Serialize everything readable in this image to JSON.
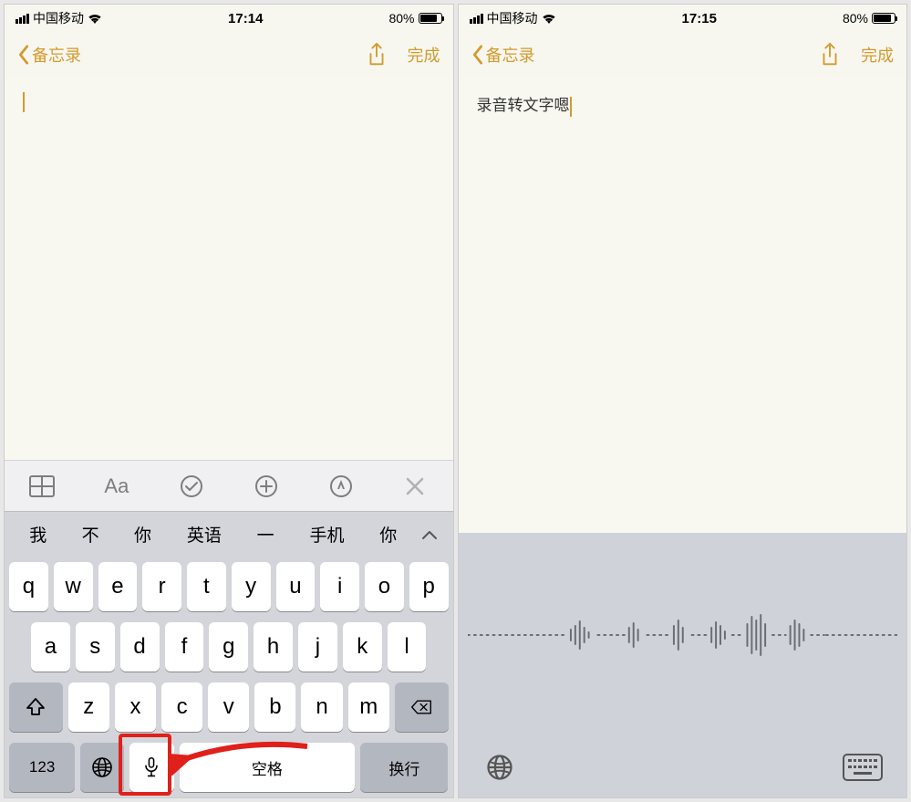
{
  "left": {
    "status": {
      "carrier": "中国移动",
      "time": "17:14",
      "battery": "80%"
    },
    "nav": {
      "back_label": "备忘录",
      "done_label": "完成"
    },
    "note_text": "",
    "format_bar": {
      "aa_label": "Aa"
    },
    "candidates": [
      "我",
      "不",
      "你",
      "英语",
      "一",
      "手机",
      "你"
    ],
    "keyboard": {
      "row1": [
        "q",
        "w",
        "e",
        "r",
        "t",
        "y",
        "u",
        "i",
        "o",
        "p"
      ],
      "row2": [
        "a",
        "s",
        "d",
        "f",
        "g",
        "h",
        "j",
        "k",
        "l"
      ],
      "row3": [
        "z",
        "x",
        "c",
        "v",
        "b",
        "n",
        "m"
      ],
      "num_label": "123",
      "space_label": "空格",
      "return_label": "换行"
    }
  },
  "right": {
    "status": {
      "carrier": "中国移动",
      "time": "17:15",
      "battery": "80%"
    },
    "nav": {
      "back_label": "备忘录",
      "done_label": "完成"
    },
    "note_text": "录音转文字嗯"
  }
}
